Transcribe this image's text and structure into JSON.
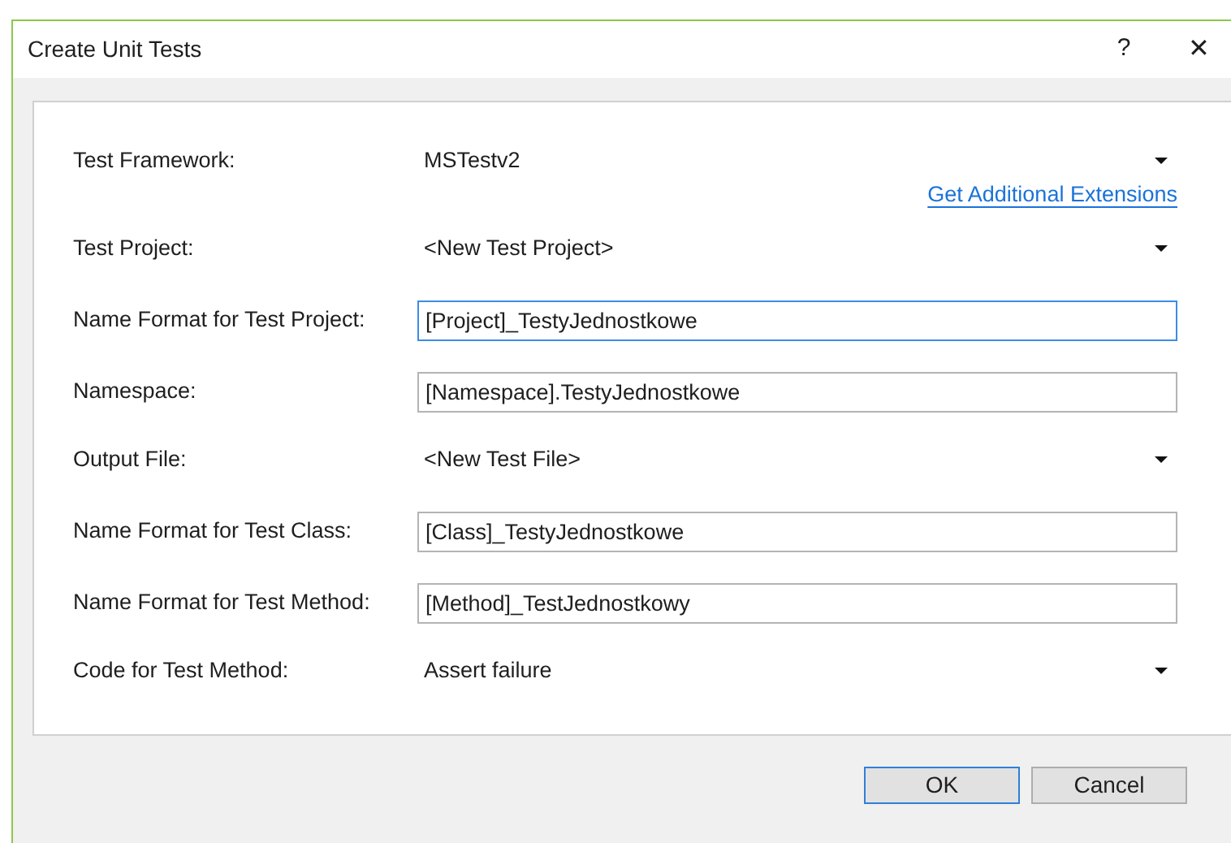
{
  "window": {
    "title": "Create Unit Tests",
    "help": "?",
    "close": "✕"
  },
  "rows": [
    {
      "kind": "dropdown",
      "label": "Test Framework:",
      "value": "MSTestv2",
      "link": "Get Additional Extensions"
    },
    {
      "kind": "dropdown",
      "label": "Test Project:",
      "value": "<New Test Project>"
    },
    {
      "kind": "field",
      "label": "Name Format for Test Project:",
      "value": "[Project]_TestyJednostkowe",
      "focused": true
    },
    {
      "kind": "field",
      "label": "Namespace:",
      "value": "[Namespace].TestyJednostkowe",
      "focused": false
    },
    {
      "kind": "dropdown",
      "label": "Output File:",
      "value": "<New Test File>"
    },
    {
      "kind": "field",
      "label": "Name Format for Test Class:",
      "value": "[Class]_TestyJednostkowe",
      "focused": false
    },
    {
      "kind": "field",
      "label": "Name Format for Test Method:",
      "value": "[Method]_TestJednostkowy",
      "focused": false
    },
    {
      "kind": "dropdown",
      "label": "Code for Test Method:",
      "value": "Assert failure"
    }
  ],
  "buttons": [
    {
      "label": "OK",
      "default": true
    },
    {
      "label": "Cancel",
      "default": false
    }
  ]
}
